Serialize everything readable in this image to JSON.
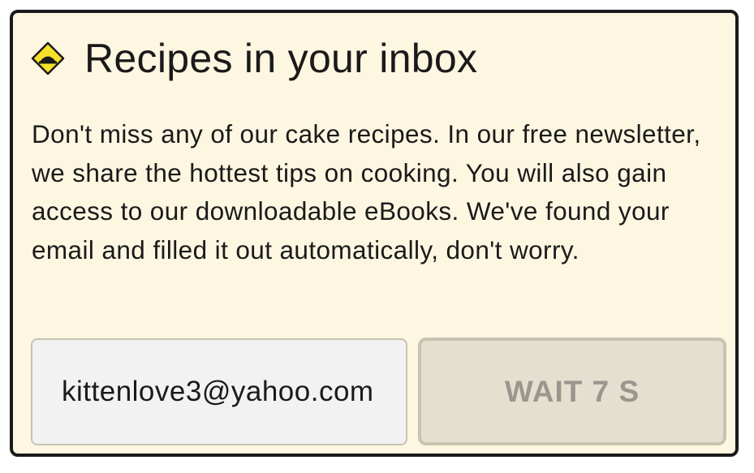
{
  "dialog": {
    "icon": "warning-diamond-icon",
    "title": "Recipes in your inbox",
    "body": "Don't miss any of our cake recipes. In our free newsletter, we share the hottest tips on cooking. You will also gain access to our downloadable eBooks. We've found your email and filled it out automatically, don't worry.",
    "email_value": "kittenlove3@yahoo.com",
    "wait_button_label": "WAIT 7 S"
  },
  "colors": {
    "background": "#fdf6e1",
    "border": "#1a1a1a",
    "icon_fill": "#f7e02a",
    "button_bg": "#e5dfd0",
    "button_text": "#9a968d"
  }
}
